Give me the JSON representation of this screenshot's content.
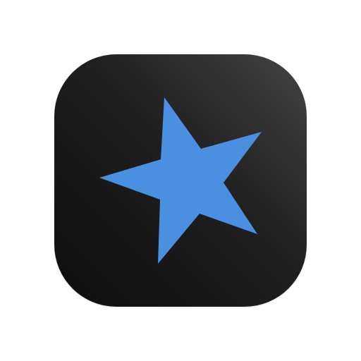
{
  "icon": {
    "name": "star-icon",
    "colors": {
      "page_background": "#ffffff",
      "tile_gradient_dark": "#0e0e0e",
      "tile_gradient_light": "#444444",
      "star_fill": "#4a8fe0"
    }
  }
}
